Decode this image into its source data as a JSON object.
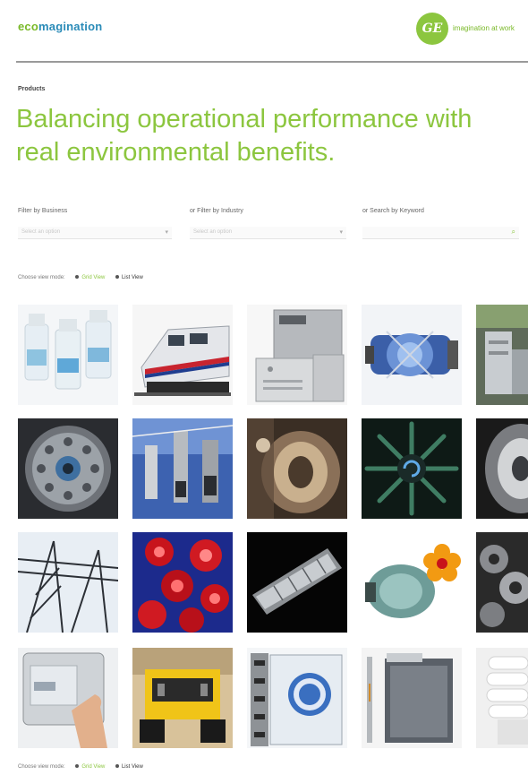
{
  "header": {
    "brand_prefix": "eco",
    "brand_suffix": "magination",
    "ge_logo_text": "GE",
    "ge_tagline": "imagination at work"
  },
  "breadcrumb": "Products",
  "headline": "Balancing operational performance with real environmental benefits.",
  "filters": [
    {
      "label": "Filter by Business",
      "placeholder": "Select an option"
    },
    {
      "label": "or Filter by Industry",
      "placeholder": "Select an option"
    },
    {
      "label": "or Search by Keyword",
      "placeholder": ""
    }
  ],
  "view_toggle": {
    "prompt": "Choose view mode:",
    "grid_label": "Grid View",
    "list_label": "List View"
  },
  "products": [
    {
      "icon": "water-bottles"
    },
    {
      "icon": "locomotive"
    },
    {
      "icon": "electrical-cabinets"
    },
    {
      "icon": "turbine-engine"
    },
    {
      "icon": "industrial-equipment"
    },
    {
      "icon": "turbine-disc"
    },
    {
      "icon": "power-insulators"
    },
    {
      "icon": "gas-turbine-interior"
    },
    {
      "icon": "jet-engine-fan"
    },
    {
      "icon": "jet-engine-blades"
    },
    {
      "icon": "transmission-tower"
    },
    {
      "icon": "red-lights"
    },
    {
      "icon": "steam-turbine-rotor"
    },
    {
      "icon": "motor-with-flower"
    },
    {
      "icon": "gear-assembly"
    },
    {
      "icon": "touch-screen-hand"
    },
    {
      "icon": "mining-truck"
    },
    {
      "icon": "ge-filtration-module"
    },
    {
      "icon": "water-treatment-unit"
    },
    {
      "icon": "cfl-bulb"
    }
  ]
}
